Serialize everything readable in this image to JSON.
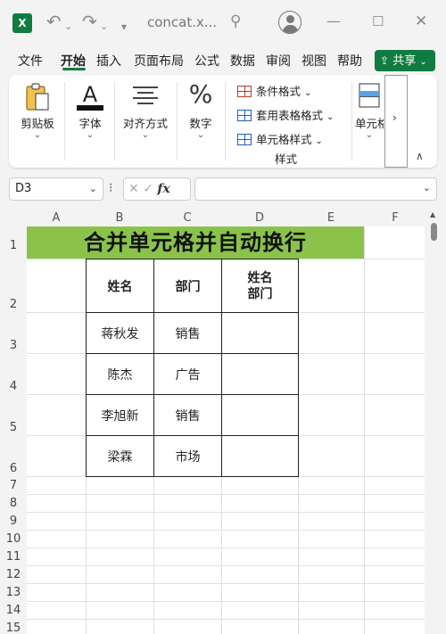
{
  "window": {
    "app_icon": "X",
    "title": "concat.x..."
  },
  "menu": {
    "tabs": [
      "文件",
      "开始",
      "插入",
      "页面布局",
      "公式",
      "数据",
      "审阅",
      "视图",
      "帮助"
    ],
    "active_tab": "开始",
    "share_label": "共享"
  },
  "ribbon": {
    "clipboard_label": "剪贴板",
    "font_label": "字体",
    "align_label": "对齐方式",
    "number_label": "数字",
    "conditional_format": "条件格式",
    "table_format": "套用表格格式",
    "cell_style": "单元格样式",
    "styles_group": "样式",
    "cells_label": "单元格"
  },
  "formula_bar": {
    "name_box": "D3",
    "fx": "fx",
    "formula": ""
  },
  "sheet": {
    "columns": [
      "A",
      "B",
      "C",
      "D",
      "E",
      "F"
    ],
    "rows": [
      "1",
      "2",
      "3",
      "4",
      "5",
      "6",
      "7",
      "8",
      "9",
      "10",
      "11",
      "12",
      "13",
      "14",
      "15"
    ],
    "banner": "合并单元格并自动换行",
    "header": {
      "name": "姓名",
      "dept": "部门",
      "combined_line1": "姓名",
      "combined_line2": "部门"
    },
    "data": [
      {
        "name": "蒋秋发",
        "dept": "销售"
      },
      {
        "name": "陈杰",
        "dept": "广告"
      },
      {
        "name": "李旭新",
        "dept": "销售"
      },
      {
        "name": "梁霖",
        "dept": "市场"
      }
    ]
  },
  "colors": {
    "accent": "#107c41",
    "banner_fill": "#8bc34a"
  }
}
